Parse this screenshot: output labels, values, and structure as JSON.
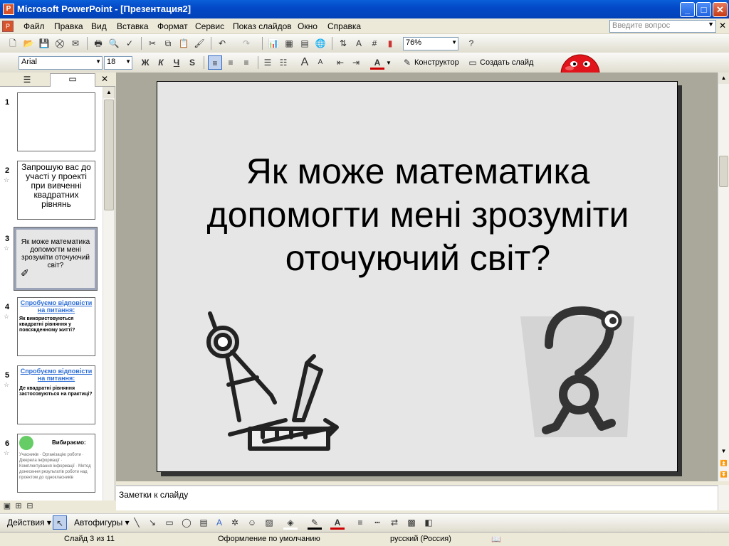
{
  "window": {
    "title": "Microsoft PowerPoint - [Презентация2]",
    "min": "_",
    "max": "□",
    "close": "✕"
  },
  "menu": [
    "Файл",
    "Правка",
    "Вид",
    "Вставка",
    "Формат",
    "Сервис",
    "Показ слайдов",
    "Окно",
    "Справка"
  ],
  "help_box": {
    "placeholder": "Введите вопрос"
  },
  "toolbar": {
    "zoom": "76%",
    "font": "Arial",
    "size": "18",
    "bold": "Ж",
    "italic": "К",
    "underline": "Ч",
    "shadow": "S",
    "designer": "Конструктор",
    "new_slide": "Создать слайд"
  },
  "slides": [
    {
      "num": "1",
      "text": ""
    },
    {
      "num": "2",
      "text": "Запрошую вас до участі у проекті при вивченні квадратних рівнянь"
    },
    {
      "num": "3",
      "text": "Як може математика допомогти мені зрозуміти оточуючий світ?"
    },
    {
      "num": "4",
      "head": "Спробуємо відповісти на питання:",
      "text": "Як використовуються квадратні рівняння у повсякденному житті?"
    },
    {
      "num": "5",
      "head": "Спробуємо відповісти на питання:",
      "text": "Де квадратні рівняння застосовуються на практиці?"
    },
    {
      "num": "6",
      "head": "Вибираємо:",
      "text": "Учасників · Організацію роботи · Джерела інформації · Комплектування інформації · Метод донесення результатів роботи над проектом до однокласників"
    }
  ],
  "main_slide": {
    "title": "Як може математика допомогти мені зрозуміти оточуючий світ?"
  },
  "notes": {
    "placeholder": "Заметки к слайду"
  },
  "drawing": {
    "actions": "Действия",
    "autoshapes": "Автофигуры"
  },
  "status": {
    "slide": "Слайд 3 из 11",
    "design": "Оформление по умолчанию",
    "lang": "русский (Россия)"
  },
  "colors": {
    "title_bar": "#0348c6",
    "slide_bg": "#e6e6e6",
    "work_bg": "#a9a89a",
    "thumb_head": "#2b6cd4"
  }
}
